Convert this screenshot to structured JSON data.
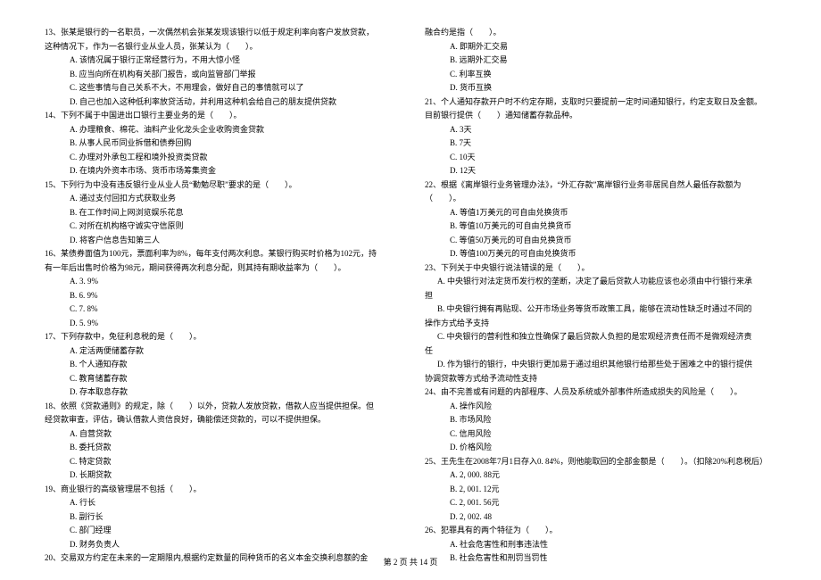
{
  "footer": "第 2 页 共 14 页",
  "left": [
    {
      "cls": "stem",
      "txt": "13、张某是银行的一名职员，一次偶然机会张某发现该银行以低于规定利率向客户发放贷款，"
    },
    {
      "cls": "cont",
      "txt": "这种情况下，作为一名银行业从业人员，张某认为（　　）。"
    },
    {
      "cls": "opt",
      "txt": "A. 该情况属于银行正常经营行为，不用大惊小怪"
    },
    {
      "cls": "opt",
      "txt": "B. 应当向所在机构有关部门报告，或向监管部门举报"
    },
    {
      "cls": "opt",
      "txt": "C. 这些事情与自己关系不大，不用理会，做好自己的事情就可以了"
    },
    {
      "cls": "opt",
      "txt": "D. 自己也加入这种低利率放贷活动，并利用这种机会给自己的朋友提供贷款"
    },
    {
      "cls": "stem",
      "txt": "14、下列不属于中国进出口银行主要业务的是（　　）。"
    },
    {
      "cls": "opt",
      "txt": "A. 办理粮食、棉花、油料产业化龙头企业收购资金贷款"
    },
    {
      "cls": "opt",
      "txt": "B. 从事人民币同业拆借和债券回购"
    },
    {
      "cls": "opt",
      "txt": "C. 办理对外承包工程和境外投资类贷款"
    },
    {
      "cls": "opt",
      "txt": "D. 在境内外资本市场、货币市场筹集资金"
    },
    {
      "cls": "stem",
      "txt": "15、下列行为中没有违反银行业从业人员“勤勉尽职”要求的是（　　）。"
    },
    {
      "cls": "opt",
      "txt": "A. 通过支付回扣方式获取业务"
    },
    {
      "cls": "opt",
      "txt": "B. 在工作时间上网浏览娱乐花息"
    },
    {
      "cls": "opt",
      "txt": "C. 对所在机构格守诚实守信原则"
    },
    {
      "cls": "opt",
      "txt": "D. 将客户信息告知第三人"
    },
    {
      "cls": "stem",
      "txt": "16、某债券面值为100元，票面利率为8%，每年支付两次利息。某银行购买时价格为102元，持"
    },
    {
      "cls": "cont",
      "txt": "有一年后出售时价格为98元，期间获得两次利息分配，则其持有期收益率为（　　）。"
    },
    {
      "cls": "opt",
      "txt": "A. 3. 9%"
    },
    {
      "cls": "opt",
      "txt": "B. 6. 9%"
    },
    {
      "cls": "opt",
      "txt": "C. 7. 8%"
    },
    {
      "cls": "opt",
      "txt": "D. 5. 9%"
    },
    {
      "cls": "stem",
      "txt": "17、下列存款中，免征利息税的是（　　）。"
    },
    {
      "cls": "opt",
      "txt": "A. 定活两便储蓄存款"
    },
    {
      "cls": "opt",
      "txt": "B. 个人通知存款"
    },
    {
      "cls": "opt",
      "txt": "C. 教育储蓄存款"
    },
    {
      "cls": "opt",
      "txt": "D. 存本取息存款"
    },
    {
      "cls": "stem",
      "txt": "18、依照《贷款通则》的规定，除（　　）以外，贷款人发放贷款，借款人应当提供担保。但"
    },
    {
      "cls": "cont",
      "txt": "经贷款审查，评估，确认借款人资信良好，确能偿还贷款的，可以不提供担保。"
    },
    {
      "cls": "opt",
      "txt": "A. 自营贷款"
    },
    {
      "cls": "opt",
      "txt": "B. 委托贷款"
    },
    {
      "cls": "opt",
      "txt": "C. 特定贷款"
    },
    {
      "cls": "opt",
      "txt": "D. 长期贷款"
    },
    {
      "cls": "stem",
      "txt": "19、商业银行的高级管理层不包括（　　）。"
    },
    {
      "cls": "opt",
      "txt": "A. 行长"
    },
    {
      "cls": "opt",
      "txt": "B. 副行长"
    },
    {
      "cls": "opt",
      "txt": "C. 部门经理"
    },
    {
      "cls": "opt",
      "txt": "D. 财务负责人"
    },
    {
      "cls": "stem",
      "txt": "20、交易双方约定在未来的一定期限内,根据约定数量的同种货币的名义本金交换利息额的金"
    }
  ],
  "right": [
    {
      "cls": "cont",
      "txt": "融合约是指（　　）。"
    },
    {
      "cls": "opt",
      "txt": "A. 即期外汇交易"
    },
    {
      "cls": "opt",
      "txt": "B. 远期外汇交易"
    },
    {
      "cls": "opt",
      "txt": "C. 利率互换"
    },
    {
      "cls": "opt",
      "txt": "D. 货币互换"
    },
    {
      "cls": "stem",
      "txt": "21、个人通知存款开户时不约定存期，支取时只要提前一定时间通知银行，约定支取日及金额。"
    },
    {
      "cls": "cont",
      "txt": "目前银行提供（　　）通知储蓄存款品种。"
    },
    {
      "cls": "opt",
      "txt": "A. 3天"
    },
    {
      "cls": "opt",
      "txt": "B. 7天"
    },
    {
      "cls": "opt",
      "txt": "C. 10天"
    },
    {
      "cls": "opt",
      "txt": "D. 12天"
    },
    {
      "cls": "stem",
      "txt": "22、根据《离岸银行业务管理办法》，“外汇存款”离岸银行业务非居民自然人最低存款额为"
    },
    {
      "cls": "cont",
      "txt": "（　　）。"
    },
    {
      "cls": "opt",
      "txt": "A. 等值1万美元的可自由兑换货币"
    },
    {
      "cls": "opt",
      "txt": "B. 等值10万美元的可自由兑换货币"
    },
    {
      "cls": "opt",
      "txt": "C. 等值50万美元的可自由兑换货币"
    },
    {
      "cls": "opt",
      "txt": "D. 等值100万美元的可自由兑换货币"
    },
    {
      "cls": "stem",
      "txt": "23、下列关于中央银行说法错误的是（　　）。"
    },
    {
      "cls": "opt-inner",
      "txt": "A. 中央银行对法定货币发行权的垄断，决定了最后贷款人功能应该也必须由中行银行来承"
    },
    {
      "cls": "cont",
      "txt": "担"
    },
    {
      "cls": "opt-inner",
      "txt": "B. 中央银行拥有再贴现、公开市场业务等货币政策工具，能够在流动性缺乏时通过不同的"
    },
    {
      "cls": "cont",
      "txt": "操作方式给予支持"
    },
    {
      "cls": "opt-inner",
      "txt": "C. 中央银行的营利性和独立性确保了最后贷款人负担的是宏观经济责任而不是微观经济责"
    },
    {
      "cls": "cont",
      "txt": "任"
    },
    {
      "cls": "opt-inner",
      "txt": "D. 作为银行的银行，中央银行更加易于通过组织其他银行给那些处于困难之中的银行提供"
    },
    {
      "cls": "cont",
      "txt": "协调贷款等方式给予流动性支持"
    },
    {
      "cls": "stem",
      "txt": "24、由不完善或有问题的内部程序、人员及系统或外部事件所造成损失的风险是（　　）。"
    },
    {
      "cls": "opt",
      "txt": "A. 操作风险"
    },
    {
      "cls": "opt",
      "txt": "B. 市场风险"
    },
    {
      "cls": "opt",
      "txt": "C. 信用风险"
    },
    {
      "cls": "opt",
      "txt": "D. 价格风险"
    },
    {
      "cls": "stem",
      "txt": "25、王先生在2008年7月1日存入0. 84%，则他能取回的全部金额是（　　）。（扣除20%利息税后）"
    },
    {
      "cls": "opt",
      "txt": "A. 2, 000. 88元"
    },
    {
      "cls": "opt",
      "txt": "B. 2, 001. 12元"
    },
    {
      "cls": "opt",
      "txt": "C. 2, 001. 56元"
    },
    {
      "cls": "opt",
      "txt": "D. 2, 002. 48"
    },
    {
      "cls": "stem",
      "txt": "26、犯罪具有的两个特征为（　　）。"
    },
    {
      "cls": "opt",
      "txt": "A. 社会危害性和刑事违法性"
    },
    {
      "cls": "opt",
      "txt": "B. 社会危害性和刑罚当罚性"
    }
  ]
}
